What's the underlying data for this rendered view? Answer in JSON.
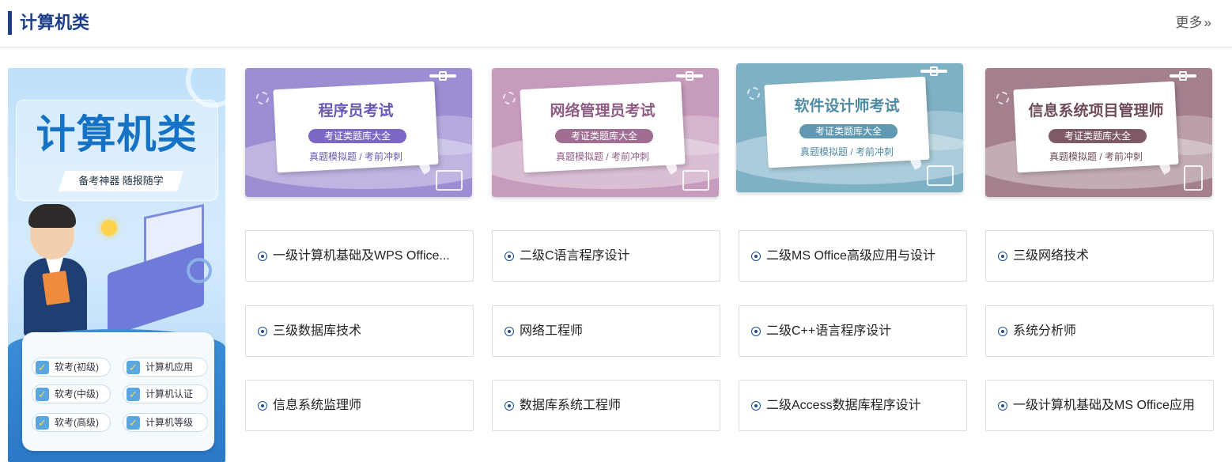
{
  "header": {
    "title": "计算机类",
    "more_label": "更多",
    "more_icon": "double-chevron-right-icon"
  },
  "banner": {
    "title": "计算机类",
    "slogan": "备考神器 随报随学",
    "tags": [
      {
        "label": "软考(初级)"
      },
      {
        "label": "计算机应用"
      },
      {
        "label": "软考(中级)"
      },
      {
        "label": "计算机认证"
      },
      {
        "label": "软考(高级)"
      },
      {
        "label": "计算机等级"
      }
    ]
  },
  "cards": [
    {
      "title": "程序员考试",
      "pill": "考证类题库大全",
      "sub": "真题模拟题 / 考前冲刺",
      "bg": "#9d8dd3",
      "accent": "#7c68c4",
      "text": "#6a57b5"
    },
    {
      "title": "网络管理员考试",
      "pill": "考证类题库大全",
      "sub": "真题模拟题 / 考前冲刺",
      "bg": "#c79bbd",
      "accent": "#a06e93",
      "text": "#8f5c83"
    },
    {
      "title": "软件设计师考试",
      "pill": "考证类题库大全",
      "sub": "真题模拟题 / 考前冲刺",
      "bg": "#7fb1c6",
      "accent": "#5f98b0",
      "text": "#4f8aa3"
    },
    {
      "title": "信息系统项目管理师",
      "pill": "考证类题库大全",
      "sub": "真题模拟题 / 考前冲刺",
      "bg": "#a4808f",
      "accent": "#7e5a69",
      "text": "#6e4b5a"
    }
  ],
  "links": [
    {
      "label": "一级计算机基础及WPS Office..."
    },
    {
      "label": "二级C语言程序设计"
    },
    {
      "label": "二级MS Office高级应用与设计"
    },
    {
      "label": "三级网络技术"
    },
    {
      "label": "三级数据库技术"
    },
    {
      "label": "网络工程师"
    },
    {
      "label": "二级C++语言程序设计"
    },
    {
      "label": "系统分析师"
    },
    {
      "label": "信息系统监理师"
    },
    {
      "label": "数据库系统工程师"
    },
    {
      "label": "二级Access数据库程序设计"
    },
    {
      "label": "一级计算机基础及MS Office应用"
    }
  ]
}
